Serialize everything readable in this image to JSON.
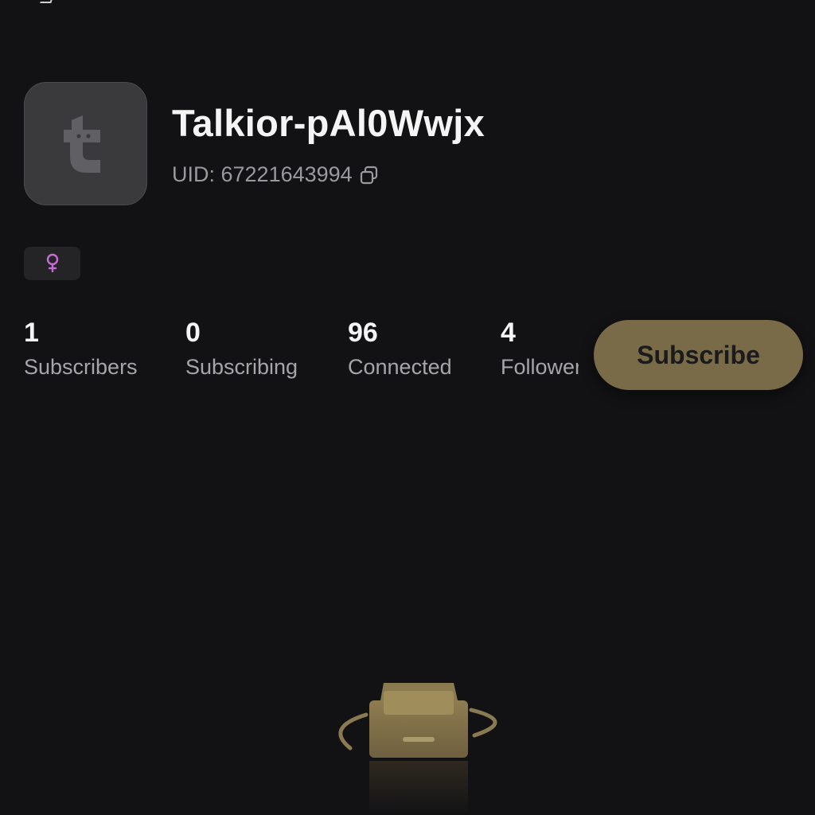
{
  "profile": {
    "username": "Talkior-pAl0Wwjx",
    "uid_text": "UID: 67221643994",
    "avatar_letter": "t",
    "gender_symbol": "♀",
    "gender_color": "#c86ad6"
  },
  "stats": [
    {
      "value": "1",
      "label": "Subscribers"
    },
    {
      "value": "0",
      "label": "Subscribing"
    },
    {
      "value": "96",
      "label": "Connected"
    },
    {
      "value": "4",
      "label": "Followers"
    }
  ],
  "actions": {
    "subscribe_label": "Subscribe"
  },
  "colors": {
    "background": "#121214",
    "accent_gold": "#8c7a52"
  },
  "icons": {
    "copy": "copy-icon",
    "gender": "female-icon",
    "empty_state": "empty-inbox-icon"
  }
}
